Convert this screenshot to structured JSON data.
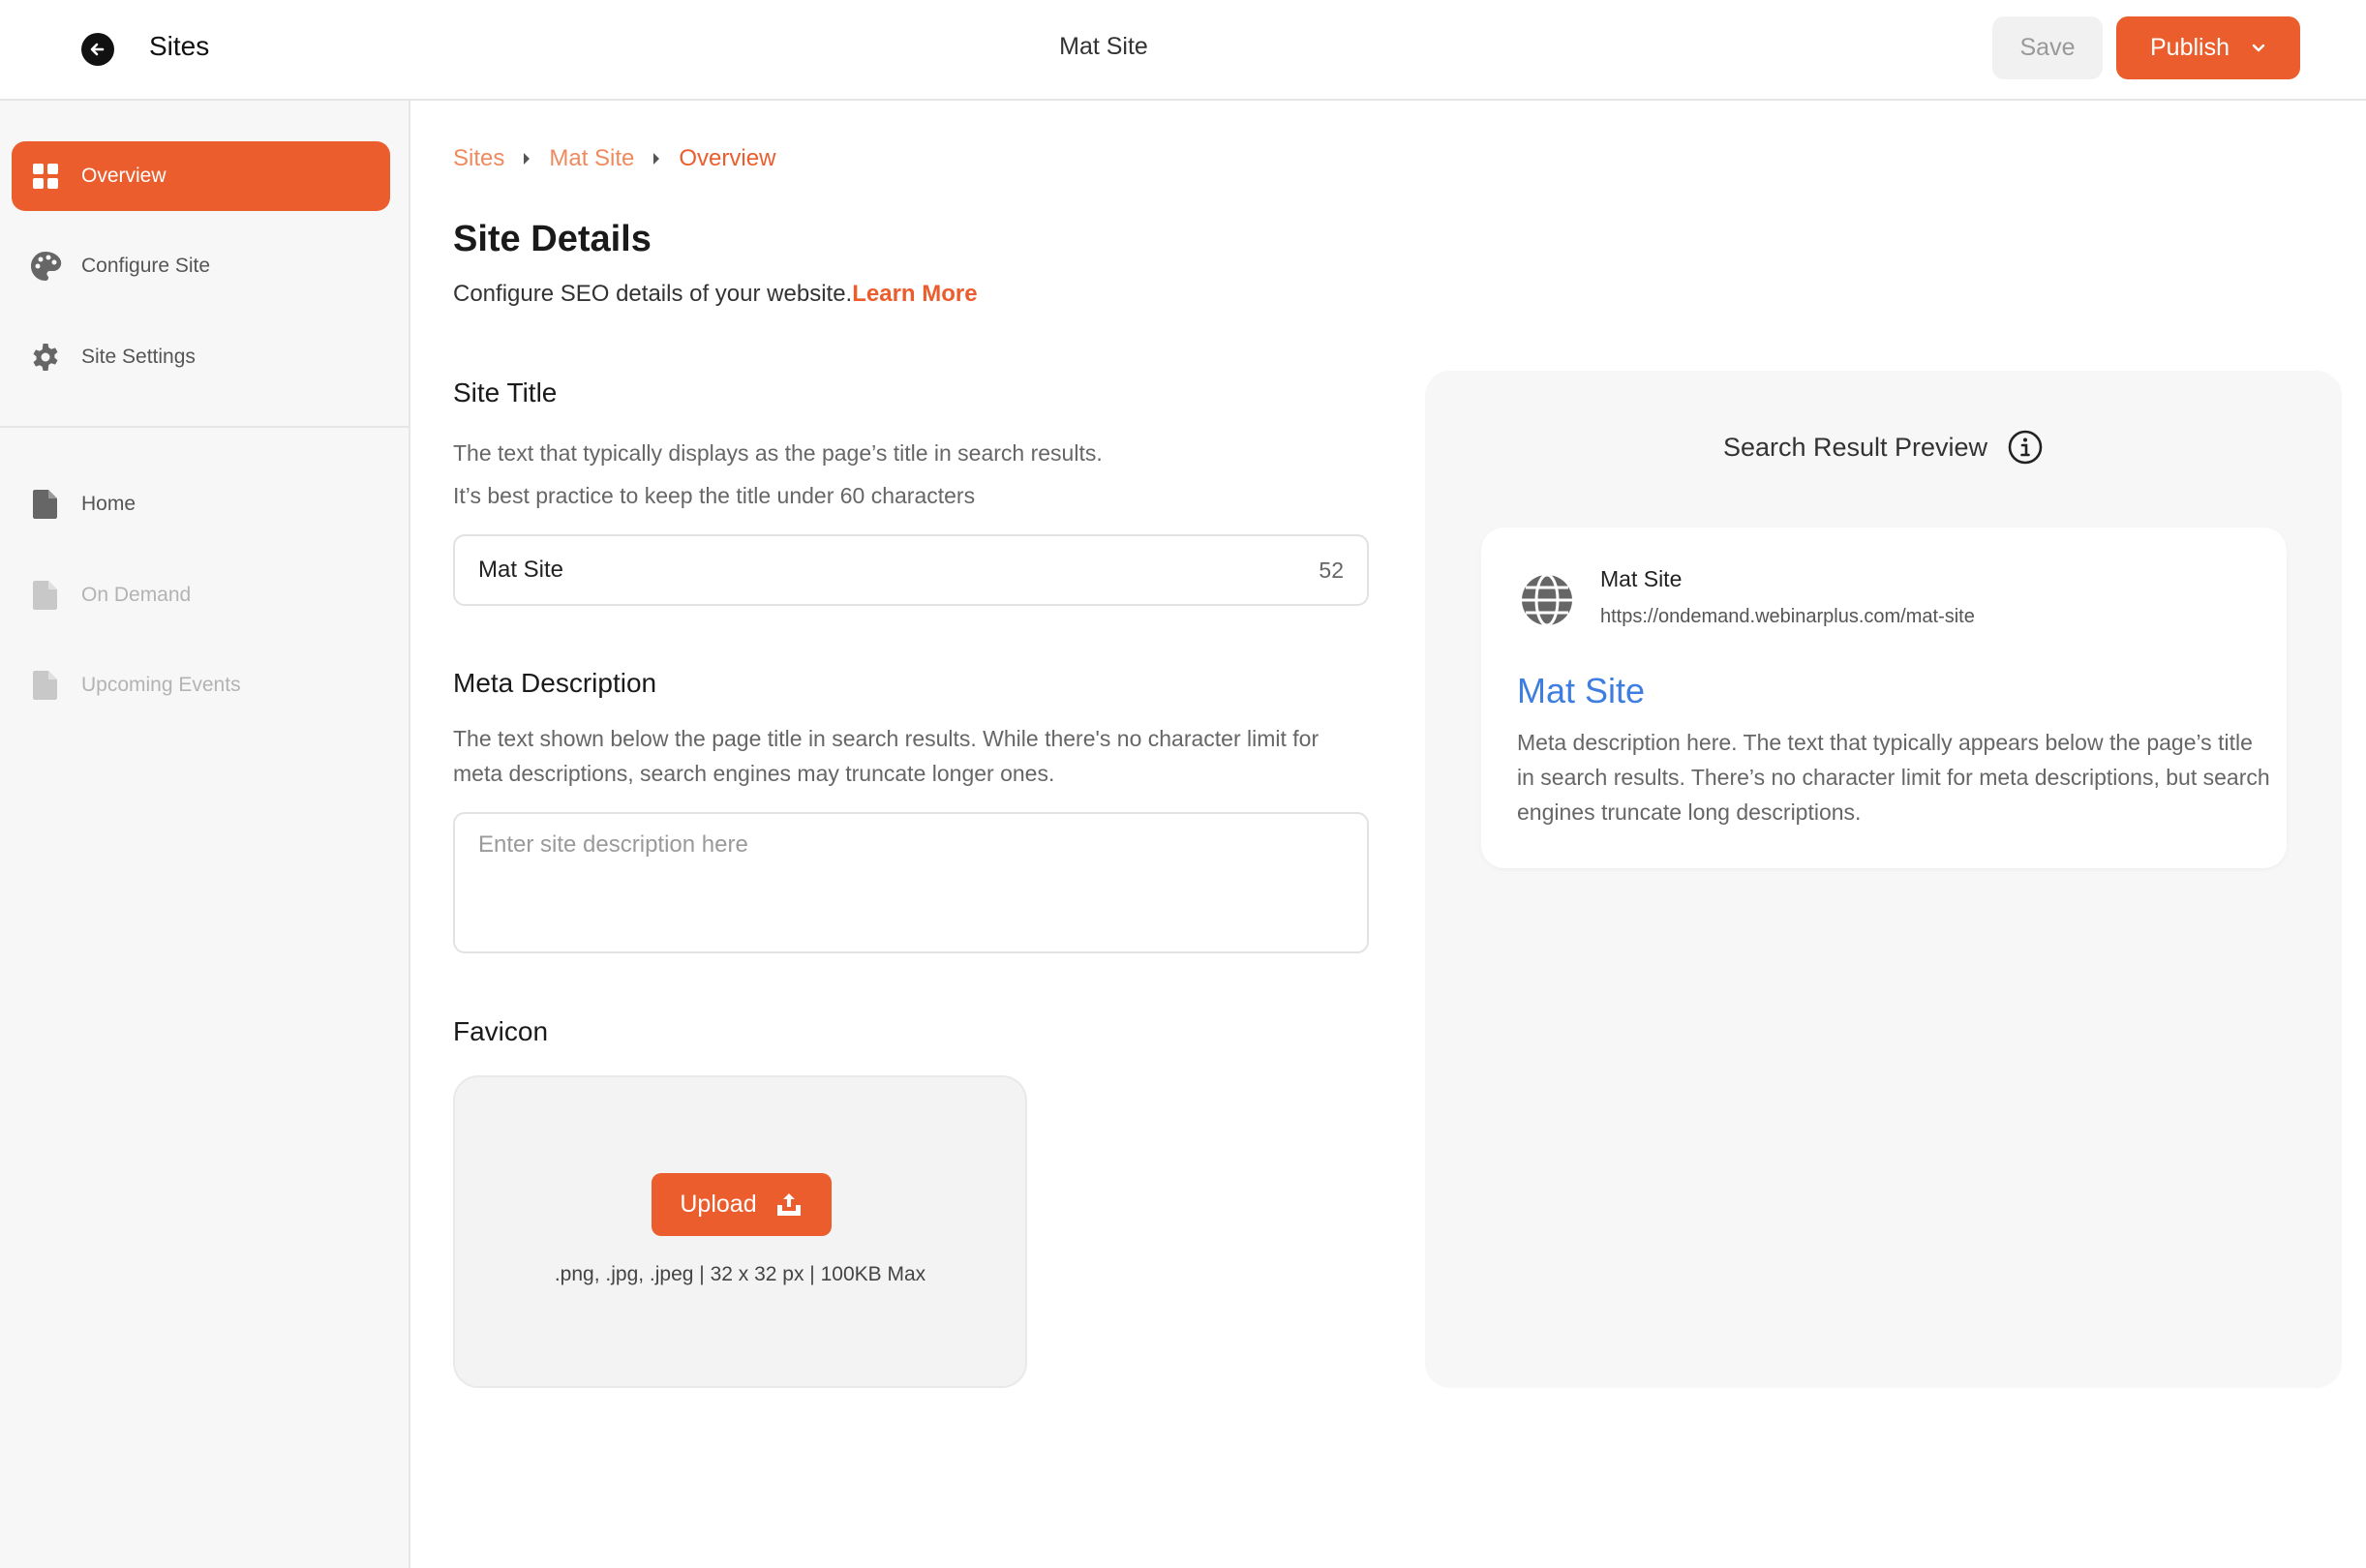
{
  "header": {
    "back_label": "Sites",
    "site_name": "Mat Site",
    "save_label": "Save",
    "publish_label": "Publish"
  },
  "sidebar": {
    "items": [
      {
        "label": "Overview",
        "icon": "dashboard-icon",
        "state": "active"
      },
      {
        "label": "Configure Site",
        "icon": "palette-icon",
        "state": "normal"
      },
      {
        "label": "Site Settings",
        "icon": "gear-icon",
        "state": "normal"
      },
      {
        "label": "Home",
        "icon": "page-icon",
        "state": "normal"
      },
      {
        "label": "On Demand",
        "icon": "page-icon",
        "state": "disabled"
      },
      {
        "label": "Upcoming Events",
        "icon": "page-icon",
        "state": "disabled"
      }
    ]
  },
  "breadcrumb": [
    "Sites",
    "Mat Site",
    "Overview"
  ],
  "page": {
    "title": "Site Details",
    "subtitle": "Configure SEO details of your website.",
    "learn_more": "Learn More"
  },
  "site_title": {
    "label": "Site Title",
    "help_line1": "The text that typically displays as the page’s title in search results.",
    "help_line2": "It’s best practice to keep the title under 60 characters",
    "value": "Mat Site",
    "count": "52"
  },
  "meta_description": {
    "label": "Meta Description",
    "help": "The text shown below the page title in search results. While there's no character limit for meta descriptions, search engines may truncate longer ones.",
    "placeholder": "Enter site description here",
    "value": ""
  },
  "favicon": {
    "label": "Favicon",
    "upload_label": "Upload",
    "hint": ".png, .jpg, .jpeg | 32 x 32 px | 100KB Max"
  },
  "preview": {
    "heading": "Search Result Preview",
    "site_name": "Mat Site",
    "url": "https://ondemand.webinarplus.com/mat-site",
    "title": "Mat Site",
    "description": "Meta description here. The text that typically appears below the page’s title in search results. There’s no character limit for meta descriptions, but search engines truncate long descriptions."
  },
  "colors": {
    "accent": "#eb5d2d",
    "link_blue": "#3d7ee0"
  }
}
